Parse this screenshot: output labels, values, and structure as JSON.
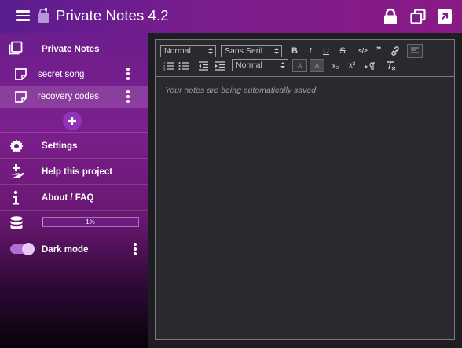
{
  "header": {
    "title": "Private Notes 4.2",
    "icons": [
      "menu-icon",
      "lock-icon",
      "copy-window-icon",
      "open-external-icon"
    ],
    "background": "#7b1d8e"
  },
  "sidebar": {
    "notebook_label": "Private Notes",
    "notes": [
      {
        "label": "secret song",
        "active": false
      },
      {
        "label": "recovery codes",
        "active": true
      }
    ],
    "items": [
      {
        "label": "Settings",
        "icon": "gear-icon"
      },
      {
        "label": "Help this project",
        "icon": "donate-hand-icon"
      },
      {
        "label": "About / FAQ",
        "icon": "info-icon"
      }
    ],
    "storage": {
      "icon": "database-icon",
      "percent_text": "1%",
      "percent": 1
    },
    "dark_mode": {
      "label": "Dark mode",
      "enabled": true
    }
  },
  "editor": {
    "toolbar": {
      "header_select": "Normal",
      "font_select": "Sans Serif",
      "size_select": "Normal",
      "bold": "B",
      "italic": "I",
      "underline": "U",
      "strike": "S",
      "code": "</>",
      "quote": "99",
      "sub": "x₂",
      "sup": "x²"
    },
    "placeholder": "Your notes are being automatically saved"
  }
}
